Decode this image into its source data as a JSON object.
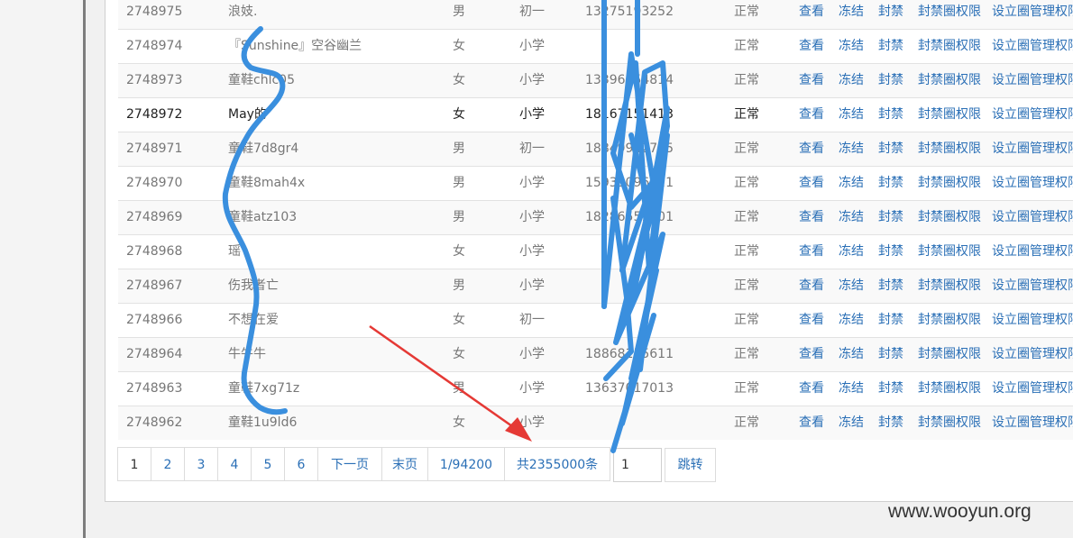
{
  "rows": [
    {
      "id": "2748975",
      "name": "浪妓.",
      "sex": "男",
      "grade": "初一",
      "phone": "13275193252",
      "status": "正常"
    },
    {
      "id": "2748974",
      "name": "『Sunshine』空谷幽兰",
      "sex": "女",
      "grade": "小学",
      "phone": "",
      "status": "正常"
    },
    {
      "id": "2748973",
      "name": "童鞋chlc05",
      "sex": "女",
      "grade": "小学",
      "phone": "13396654814",
      "status": "正常"
    },
    {
      "id": "2748972",
      "name": "May的",
      "sex": "女",
      "grade": "小学",
      "phone": "18167151413",
      "status": "正常"
    },
    {
      "id": "2748971",
      "name": "童鞋7d8gr4",
      "sex": "男",
      "grade": "初一",
      "phone": "18849942715",
      "status": "正常"
    },
    {
      "id": "2748970",
      "name": "童鞋8mah4x",
      "sex": "男",
      "grade": "小学",
      "phone": "15931096821",
      "status": "正常"
    },
    {
      "id": "2748969",
      "name": "童鞋atz103",
      "sex": "男",
      "grade": "小学",
      "phone": "18286551301",
      "status": "正常"
    },
    {
      "id": "2748968",
      "name": "瑶",
      "sex": "女",
      "grade": "小学",
      "phone": "",
      "status": "正常"
    },
    {
      "id": "2748967",
      "name": "伤我者亡",
      "sex": "男",
      "grade": "小学",
      "phone": "",
      "status": "正常"
    },
    {
      "id": "2748966",
      "name": "不想在爱",
      "sex": "女",
      "grade": "初一",
      "phone": "",
      "status": "正常"
    },
    {
      "id": "2748964",
      "name": "牛牛牛",
      "sex": "女",
      "grade": "小学",
      "phone": "18868155611",
      "status": "正常"
    },
    {
      "id": "2748963",
      "name": "童鞋7xg71z",
      "sex": "男",
      "grade": "小学",
      "phone": "13637017013",
      "status": "正常"
    },
    {
      "id": "2748962",
      "name": "童鞋1u9ld6",
      "sex": "女",
      "grade": "小学",
      "phone": "",
      "status": "正常"
    }
  ],
  "actions": {
    "view": "查看",
    "freeze": "冻结",
    "ban": "封禁",
    "ban_circle": "封禁圈权限",
    "set_admin": "设立圈管理权限"
  },
  "pagination": {
    "pages": [
      "1",
      "2",
      "3",
      "4",
      "5",
      "6"
    ],
    "next": "下一页",
    "last": "末页",
    "page_info": "1/94200",
    "total": "共2355000条",
    "jump_value": "1",
    "jump_label": "跳转"
  },
  "watermark": "www.wooyun.org",
  "colors": {
    "link": "#2a6fb6",
    "scribble": "#3a8fde",
    "arrow": "#e53935"
  }
}
